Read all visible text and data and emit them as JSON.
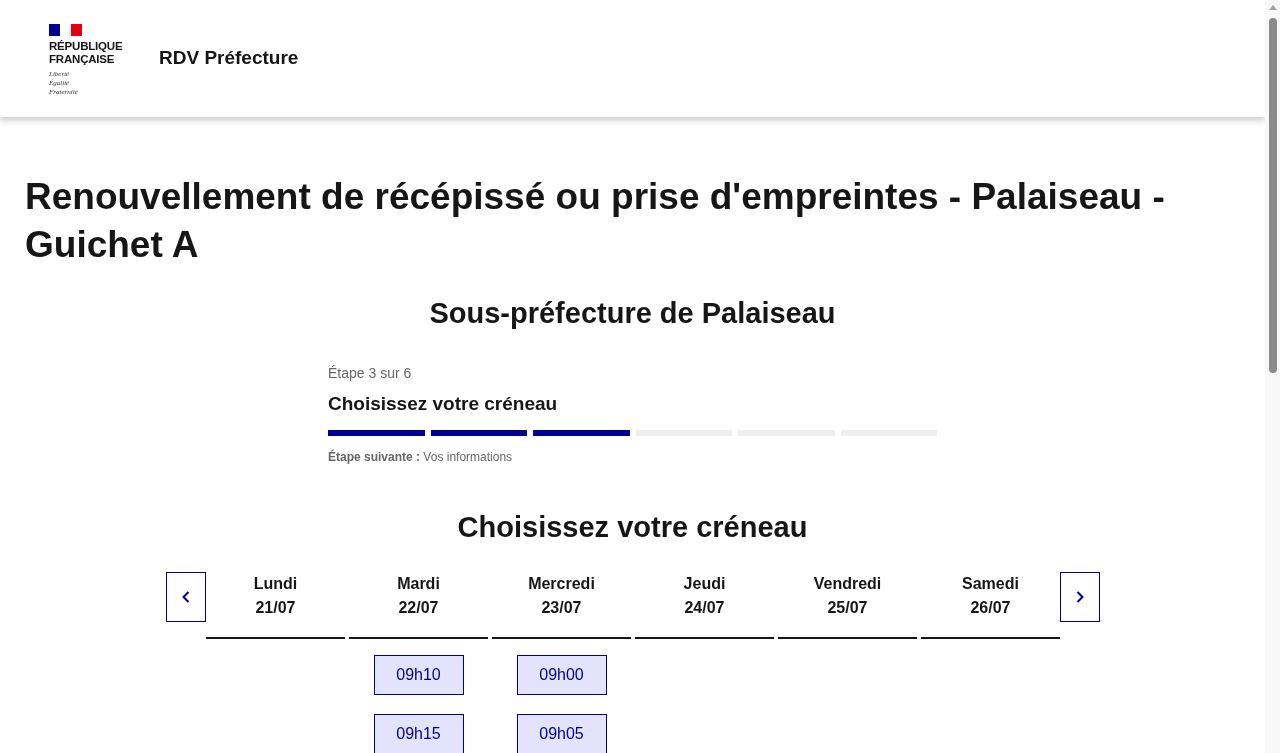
{
  "header": {
    "brand": "RÉPUBLIQUE FRANÇAISE",
    "motto": "Liberté Égalité Fraternité",
    "service_name": "RDV Préfecture"
  },
  "page_title": "Renouvellement de récépissé ou prise d'empreintes - Palaiseau - Guichet A",
  "site_name": "Sous-préfecture de Palaiseau",
  "stepper": {
    "step_label": "Étape 3 sur 6",
    "step_title": "Choisissez votre créneau",
    "segments": [
      {
        "complete": true
      },
      {
        "complete": true
      },
      {
        "complete": true
      },
      {
        "complete": false
      },
      {
        "complete": false
      },
      {
        "complete": false
      }
    ],
    "next_step": "**Étape suivante :** Vos informations"
  },
  "slot_picker": {
    "title": "Choisissez votre créneau",
    "days": [
      {
        "name": "Lundi",
        "date": "21/07"
      },
      {
        "name": "Mardi",
        "date": "22/07",
        "slots": [
          "09h10",
          "09h15"
        ]
      },
      {
        "name": "Mercredi",
        "date": "23/07",
        "slots": [
          "09h00",
          "09h05"
        ]
      },
      {
        "name": "Jeudi",
        "date": "24/07"
      },
      {
        "name": "Vendredi",
        "date": "25/07"
      },
      {
        "name": "Samedi",
        "date": "26/07"
      }
    ]
  }
}
